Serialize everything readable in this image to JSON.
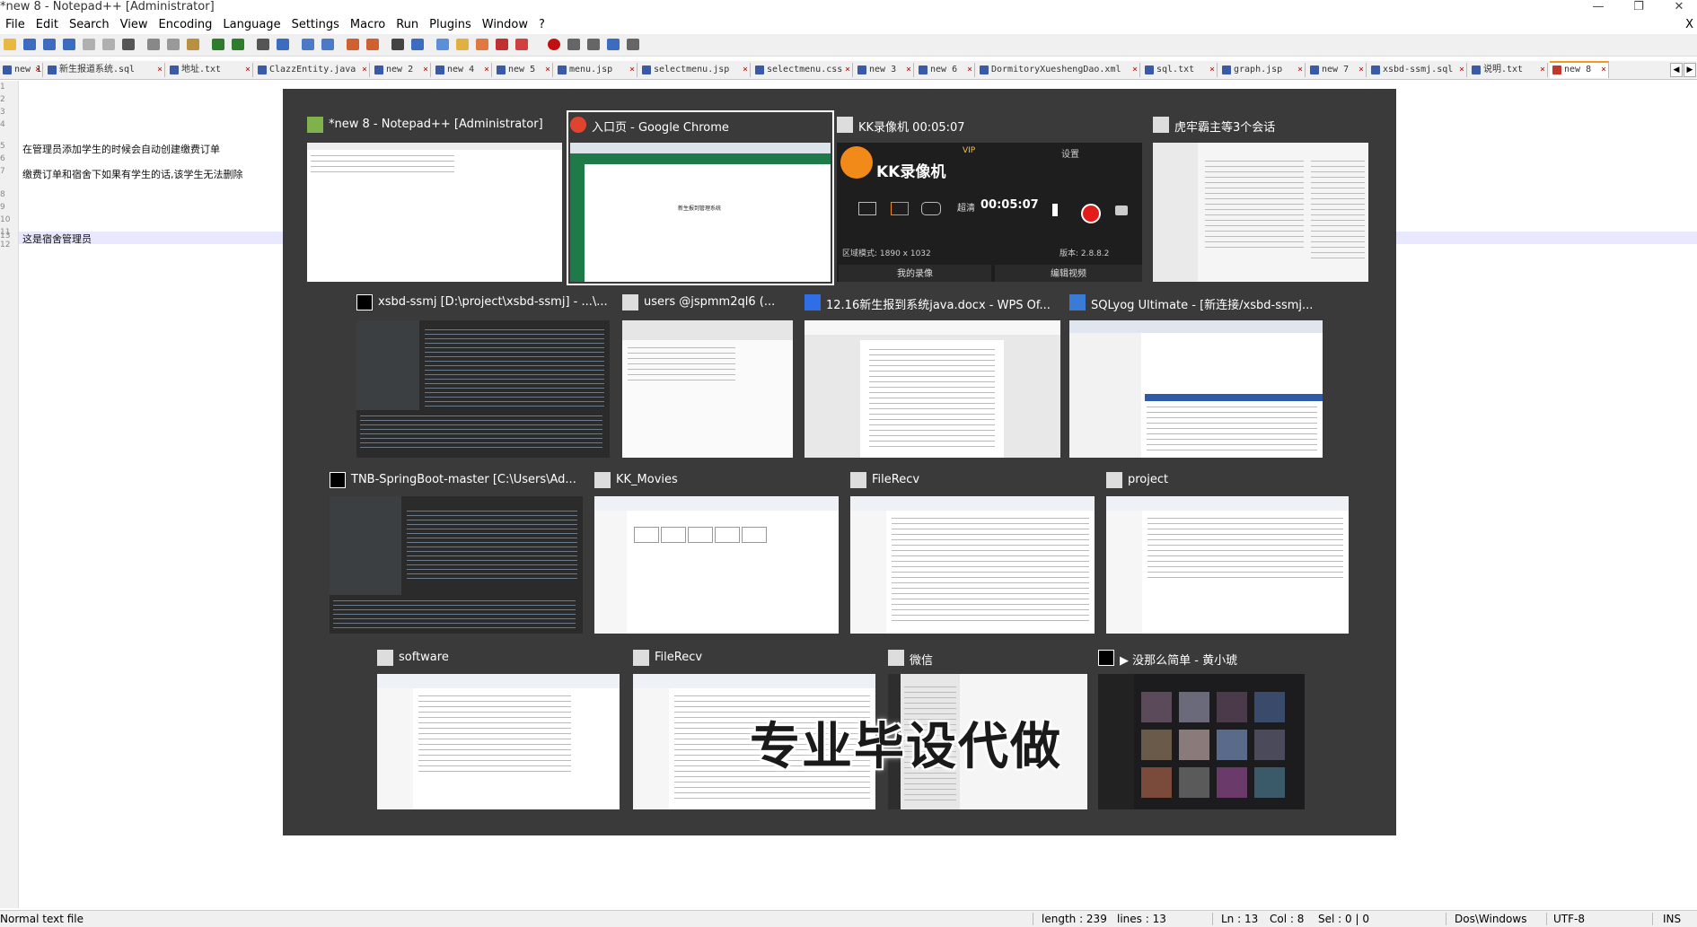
{
  "app": {
    "title": "*new 8 - Notepad++ [Administrator]",
    "window_controls": [
      "—",
      "❐",
      "✕"
    ]
  },
  "menu": {
    "items": [
      "File",
      "Edit",
      "Search",
      "View",
      "Encoding",
      "Language",
      "Settings",
      "Macro",
      "Run",
      "Plugins",
      "Window",
      "?"
    ],
    "close": "X"
  },
  "tabs": [
    "new 1",
    "新生报道系统.sql",
    "地址.txt",
    "ClazzEntity.java",
    "new 2",
    "new 4",
    "new 5",
    "menu.jsp",
    "selectmenu.jsp",
    "selectmenu.css",
    "new 3",
    "new 6",
    "DormitoryXueshengDao.xml",
    "sql.txt",
    "graph.jsp",
    "new 7",
    "xsbd-ssmj.sql",
    "说明.txt",
    "new 8"
  ],
  "tab_nav": [
    "◀",
    "▶"
  ],
  "editor": {
    "line_numbers": [
      "1",
      "2",
      "3",
      "4",
      "5",
      "6",
      "7",
      "8",
      "9",
      "10",
      "11",
      "12",
      "13"
    ],
    "lines": [
      "",
      "",
      "",
      "",
      "在管理员添加学生的时候会自动创建缴费订单",
      "",
      "缴费订单和宿舍下如果有学生的话,该学生无法删除",
      "",
      "",
      "",
      "",
      "",
      "这是宿舍管理员"
    ]
  },
  "status": {
    "file_type": "Normal text file",
    "length": "length : 239",
    "lines": "lines : 13",
    "ln": "Ln : 13",
    "col": "Col : 8",
    "sel": "Sel : 0 | 0",
    "eol": "Dos\\Windows",
    "encoding": "UTF-8",
    "mode": "INS"
  },
  "switcher": {
    "windows": [
      {
        "title": "*new 8 - Notepad++ [Administrator]",
        "icon": "notepadpp-icon",
        "color": "#7fb24a"
      },
      {
        "title": "入口页 - Google Chrome",
        "icon": "chrome-icon",
        "color": "#e0442f",
        "selected": true,
        "thumb_text": "新生报到管理系统"
      },
      {
        "title": "KK录像机 00:05:07",
        "icon": "app-window-icon",
        "color": "#dddddd"
      },
      {
        "title": "虎牢霸主等3个会话",
        "icon": "app-window-icon",
        "color": "#dddddd"
      },
      {
        "title": "xsbd-ssmj [D:\\project\\xsbd-ssmj] - ...\\...",
        "icon": "jetbrains-icon",
        "color": "#000000"
      },
      {
        "title": "users @jspmm2ql6 (...",
        "icon": "app-window-icon",
        "color": "#dddddd"
      },
      {
        "title": "12.16新生报到系统java.docx - WPS Of...",
        "icon": "wps-icon",
        "color": "#2f6ee6"
      },
      {
        "title": "SQLyog Ultimate - [新连接/xsbd-ssmj...",
        "icon": "sqlyog-icon",
        "color": "#3a7bd5"
      },
      {
        "title": "TNB-SpringBoot-master [C:\\Users\\Ad...",
        "icon": "jetbrains-icon",
        "color": "#000000"
      },
      {
        "title": "KK_Movies",
        "icon": "folder-window-icon",
        "color": "#dddddd"
      },
      {
        "title": "FileRecv",
        "icon": "folder-window-icon",
        "color": "#dddddd"
      },
      {
        "title": "project",
        "icon": "folder-window-icon",
        "color": "#dddddd"
      },
      {
        "title": "software",
        "icon": "folder-window-icon",
        "color": "#dddddd"
      },
      {
        "title": "FileRecv",
        "icon": "folder-window-icon",
        "color": "#dddddd"
      },
      {
        "title": "微信",
        "icon": "app-window-icon",
        "color": "#dddddd"
      },
      {
        "title": "▶ 没那么简单 - 黄小琥",
        "icon": "music-player-icon",
        "color": "#000000"
      }
    ],
    "kk_recorder": {
      "brand": "KK录像机",
      "vip": "VIP",
      "settings": "设置",
      "quality": "超清",
      "time": "00:05:07",
      "region": "区域模式: 1890 x 1032",
      "version": "版本: 2.8.8.2",
      "btn_my_recordings": "我的录像",
      "btn_edit_video": "编辑视频"
    },
    "watermark": "专业毕设代做"
  }
}
